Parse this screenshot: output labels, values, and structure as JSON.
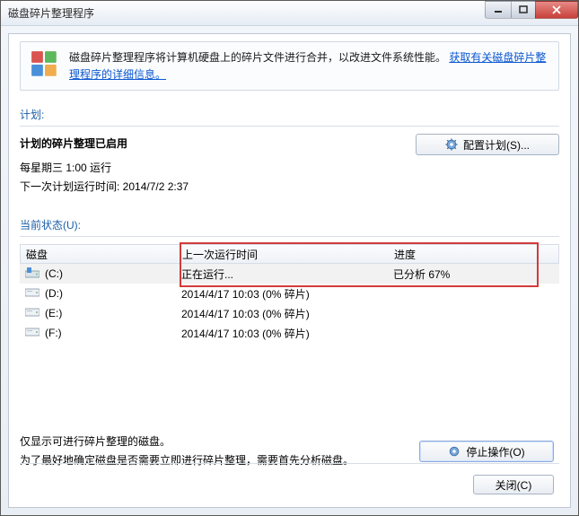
{
  "title": "磁盘碎片整理程序",
  "banner": {
    "text_prefix": "磁盘碎片整理程序将计算机硬盘上的碎片文件进行合并，以改进文件系统性能。",
    "link": "获取有关磁盘碎片整理程序的详细信息。"
  },
  "sections": {
    "schedule_label": "计划:",
    "status_label": "当前状态(U):"
  },
  "schedule": {
    "title": "计划的碎片整理已启用",
    "line1": "每星期三 1:00 运行",
    "line2": "下一次计划运行时间: 2014/7/2 2:37",
    "config_button": "配置计划(S)..."
  },
  "table": {
    "headers": {
      "disk": "磁盘",
      "last": "上一次运行时间",
      "progress": "进度"
    },
    "rows": [
      {
        "drive": "(C:)",
        "type": "sys",
        "last": "正在运行...",
        "progress": "已分析 67%",
        "selected": true
      },
      {
        "drive": "(D:)",
        "type": "hdd",
        "last": "2014/4/17 10:03 (0% 碎片)",
        "progress": "",
        "selected": false
      },
      {
        "drive": "(E:)",
        "type": "hdd",
        "last": "2014/4/17 10:03 (0% 碎片)",
        "progress": "",
        "selected": false
      },
      {
        "drive": "(F:)",
        "type": "hdd",
        "last": "2014/4/17 10:03 (0% 碎片)",
        "progress": "",
        "selected": false
      }
    ]
  },
  "hint": {
    "line1": "仅显示可进行碎片整理的磁盘。",
    "line2": "为了最好地确定磁盘是否需要立即进行碎片整理，需要首先分析磁盘。"
  },
  "buttons": {
    "stop": "停止操作(O)",
    "close": "关闭(C)"
  }
}
